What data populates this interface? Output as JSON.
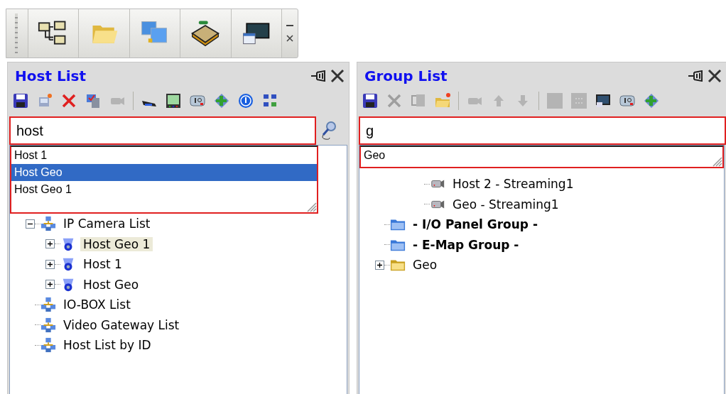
{
  "host_list": {
    "title": "Host List",
    "toolbar": [
      {
        "disabled": false
      },
      {
        "disabled": false
      },
      {
        "disabled": false
      },
      {
        "disabled": false
      },
      {
        "disabled": true
      },
      {
        "disabled": false
      },
      {
        "disabled": false
      },
      {
        "disabled": false
      },
      {
        "disabled": false
      },
      {
        "disabled": false
      },
      {
        "disabled": false
      }
    ],
    "search": {
      "value": "host"
    },
    "suggestions": [
      {
        "label": "Host 1",
        "selected": false
      },
      {
        "label": "Host Geo",
        "selected": true
      },
      {
        "label": "Host Geo 1",
        "selected": false
      }
    ],
    "tree": [
      {
        "label": "IP Camera List",
        "kind": "list",
        "expanded": true,
        "selected": false,
        "children": [
          {
            "label": "Host Geo 1",
            "kind": "camera",
            "expanded": false,
            "selected": true
          },
          {
            "label": "Host 1",
            "kind": "camera",
            "expanded": false,
            "selected": false
          },
          {
            "label": "Host Geo",
            "kind": "camera",
            "expanded": false,
            "selected": false
          }
        ]
      },
      {
        "label": "IO-BOX List",
        "kind": "list",
        "selected": false
      },
      {
        "label": "Video Gateway List",
        "kind": "list",
        "selected": false
      },
      {
        "label": "Host List by ID",
        "kind": "list",
        "selected": false
      }
    ]
  },
  "group_list": {
    "title": "Group List",
    "toolbar": [
      {
        "disabled": false
      },
      {
        "disabled": true
      },
      {
        "disabled": true
      },
      {
        "disabled": false
      },
      {
        "disabled": true
      },
      {
        "disabled": true
      },
      {
        "disabled": true
      },
      {
        "disabled": true
      },
      {
        "disabled": true
      },
      {
        "disabled": false
      },
      {
        "disabled": false
      },
      {
        "disabled": false
      }
    ],
    "search": {
      "value": "g"
    },
    "suggestions": [
      {
        "label": "Geo",
        "selected": false
      }
    ],
    "tree": [
      {
        "label": "Host 2 - Streaming1",
        "kind": "stream",
        "selected": false
      },
      {
        "label": "Geo - Streaming1",
        "kind": "stream",
        "selected": false
      },
      {
        "label": "- I/O Panel Group -",
        "kind": "group",
        "selected": false
      },
      {
        "label": "- E-Map Group -",
        "kind": "group",
        "selected": false
      },
      {
        "label": "Geo",
        "kind": "folder",
        "expanded": false,
        "selected": false
      }
    ]
  }
}
